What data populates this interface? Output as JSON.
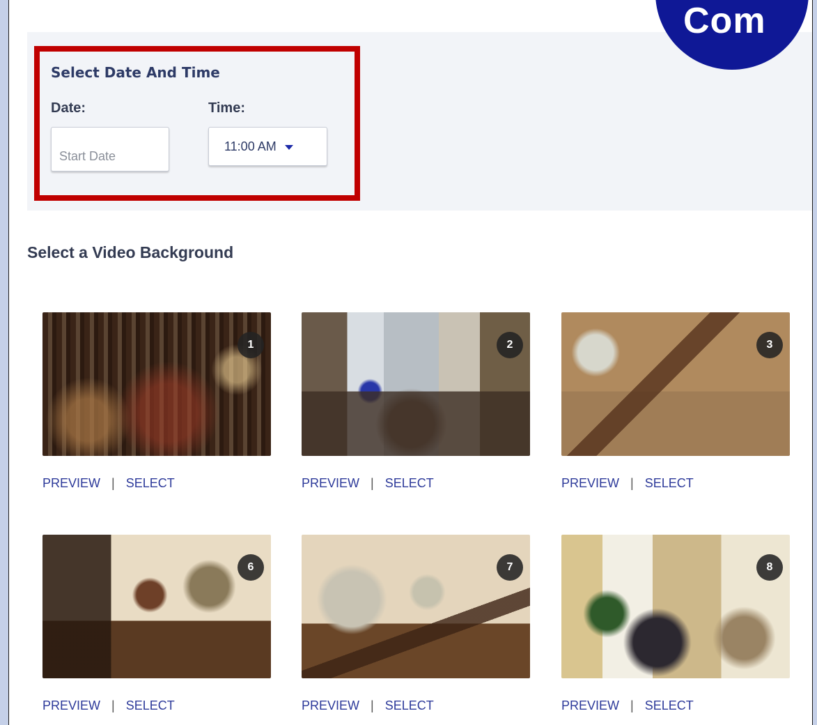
{
  "logo": {
    "text": "Com"
  },
  "schedule": {
    "title": "Select Date And Time",
    "date_label": "Date:",
    "date_placeholder": "Start Date",
    "time_label": "Time:",
    "time_value": "11:00 AM"
  },
  "videos": {
    "heading": "Select a Video Background",
    "preview_label": "PREVIEW",
    "separator": "|",
    "select_label": "SELECT",
    "items": [
      {
        "number": "1"
      },
      {
        "number": "2"
      },
      {
        "number": "3"
      },
      {
        "number": "6"
      },
      {
        "number": "7"
      },
      {
        "number": "8"
      }
    ]
  },
  "colors": {
    "highlight_border": "#c00000",
    "link": "#2d3a9a",
    "logo_bg": "#0f1896"
  }
}
